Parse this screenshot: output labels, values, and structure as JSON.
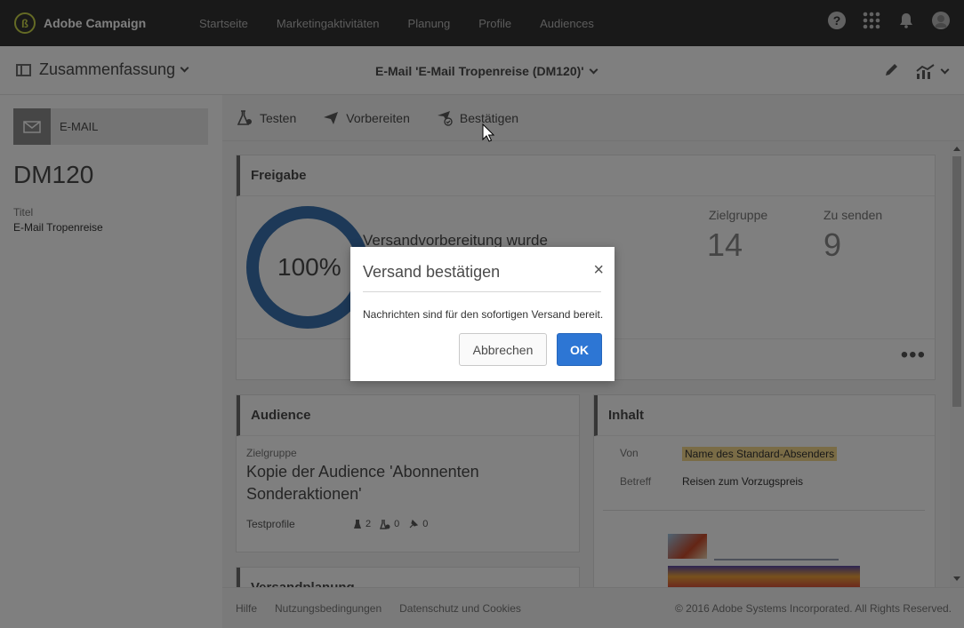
{
  "app": {
    "name": "Adobe Campaign"
  },
  "nav": {
    "links": [
      "Startseite",
      "Marketingaktivitäten",
      "Planung",
      "Profile",
      "Audiences"
    ]
  },
  "header": {
    "summary_label": "Zusammenfassung",
    "doc_title": "E-Mail 'E-Mail Tropenreise (DM120)'"
  },
  "left": {
    "type_label": "E-MAIL",
    "code": "DM120",
    "title_label": "Titel",
    "title_value": "E-Mail Tropenreise"
  },
  "actions": [
    {
      "label": "Testen",
      "icon": "flask-icon"
    },
    {
      "label": "Vorbereiten",
      "icon": "paper-plane-icon"
    },
    {
      "label": "Bestätigen",
      "icon": "send-check-icon"
    }
  ],
  "freigabe": {
    "heading": "Freigabe",
    "progress_text": "100%",
    "progress": 1.0,
    "status_text": "Versandvorbereitung wurde",
    "zielgruppe_label": "Zielgruppe",
    "zielgruppe_value": "14",
    "zu_senden_label": "Zu senden",
    "zu_senden_value": "9",
    "more": "•••"
  },
  "audience": {
    "heading": "Audience",
    "zielgruppe_label": "Zielgruppe",
    "name": "Kopie der Audience 'Abonnenten Sonderaktionen'",
    "testprofile_label": "Testprofile",
    "counts": [
      "2",
      "0",
      "0"
    ]
  },
  "inhalt": {
    "heading": "Inhalt",
    "von_label": "Von",
    "von_value": "Name des Standard-Absenders",
    "betreff_label": "Betreff",
    "betreff_value": "Reisen zum Vorzugspreis"
  },
  "next_section": {
    "heading": "Versandplanung"
  },
  "footer": {
    "links": [
      "Hilfe",
      "Nutzungsbedingungen",
      "Datenschutz und Cookies"
    ],
    "copyright": "© 2016 Adobe Systems Incorporated. All Rights Reserved."
  },
  "modal": {
    "title": "Versand bestätigen",
    "message": "Nachrichten sind für den sofortigen Versand bereit.",
    "cancel_label": "Abbrechen",
    "ok_label": "OK"
  },
  "colors": {
    "primary": "#2d76d4",
    "donut": "#3b73b0",
    "highlight": "#f5d98c",
    "topbar": "#323232"
  }
}
